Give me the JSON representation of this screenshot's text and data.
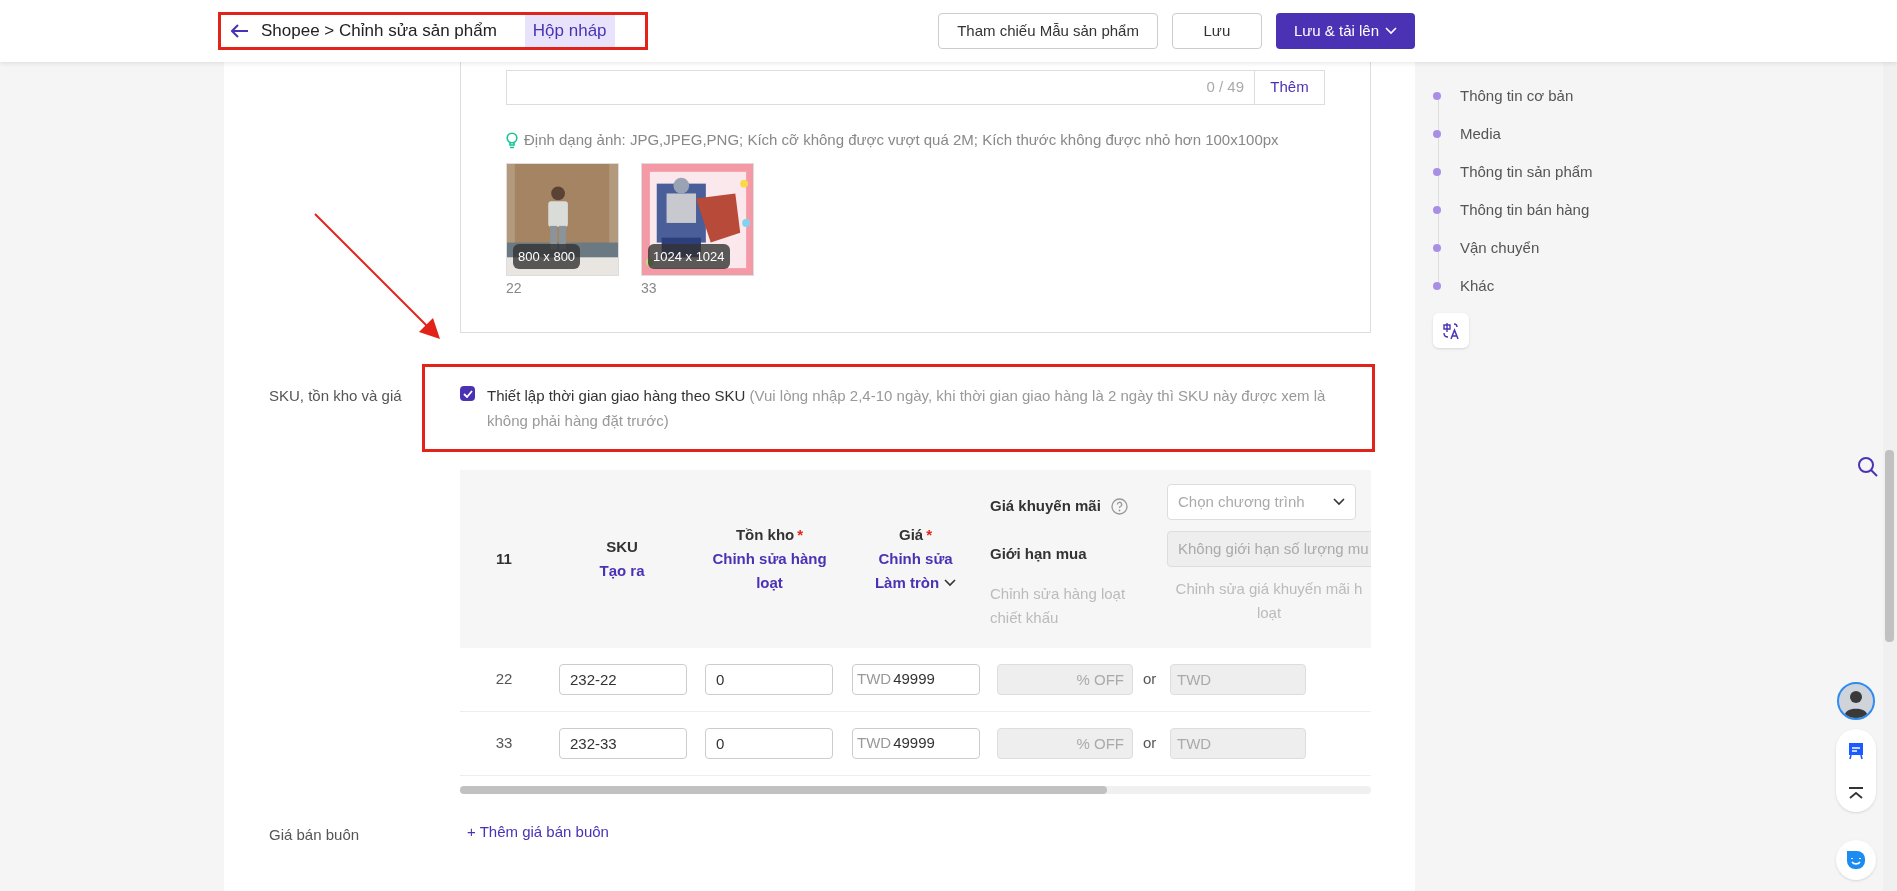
{
  "header": {
    "breadcrumb": "Shopee > Chỉnh sửa sản phẩm",
    "badge": "Hộp nháp",
    "buttons": [
      {
        "label": "Tham chiếu Mẫu sản phẩm",
        "kind": "outline"
      },
      {
        "label": "Lưu",
        "kind": "outline"
      },
      {
        "label": "Lưu & tải lên",
        "kind": "primary"
      }
    ]
  },
  "media": {
    "counter": "0 / 49",
    "add_button": "Thêm",
    "hint": "Định dạng ảnh: JPG,JPEG,PNG; Kích cỡ không được vượt quá 2M; Kích thước không được nhỏ hơn 100x100px",
    "images": [
      {
        "kind": "picture",
        "size": "800 x 800",
        "caption": "22"
      },
      {
        "kind": "picture",
        "size": "1024 x 1024",
        "caption": "33"
      }
    ]
  },
  "sku_section": {
    "label": "SKU, tồn kho và giá",
    "option": {
      "checked": true,
      "label": "Thiết lập thời gian giao hàng theo SKU",
      "note": "(Vui lòng nhập 2,4-10 ngày, khi thời gian giao hàng là 2 ngày thì SKU này được xem là không phải hàng đặt trước)"
    }
  },
  "table": {
    "index_header": "11",
    "sku": {
      "title": "SKU",
      "link": "Tạo ra"
    },
    "stock": {
      "title": "Tồn kho",
      "required_mark": "*",
      "link": "Chỉnh sửa hàng loạt"
    },
    "price": {
      "title": "Giá",
      "required_mark": "*",
      "link": "Chỉnh sửa",
      "dropdown": "Làm tròn"
    },
    "promo": {
      "price_label": "Giá khuyến mãi",
      "limit_label": "Giới hạn mua",
      "bulk_discount": "Chỉnh sửa hàng loạt chiết khấu",
      "program_placeholder": "Chọn chương trình",
      "limit_placeholder": "Không giới hạn số lượng mu",
      "bulk_price": [
        "Chỉnh sửa giá khuyến mãi h",
        "loạt"
      ]
    },
    "rows": [
      {
        "name": "22",
        "sku": "232-22",
        "stock": "0",
        "currency": "TWD",
        "price": "49999",
        "discount_placeholder": "% OFF",
        "or": "or",
        "promo_placeholder": "TWD"
      },
      {
        "name": "33",
        "sku": "232-33",
        "stock": "0",
        "currency": "TWD",
        "price": "49999",
        "discount_placeholder": "% OFF",
        "or": "or",
        "promo_placeholder": "TWD"
      }
    ]
  },
  "wholesale": {
    "label": "Giá bán buôn",
    "link": "+ Thêm giá bán buôn"
  },
  "nav": {
    "items": [
      "Thông tin cơ bản",
      "Media",
      "Thông tin sản phẩm",
      "Thông tin bán hàng",
      "Vận chuyển",
      "Khác"
    ]
  }
}
